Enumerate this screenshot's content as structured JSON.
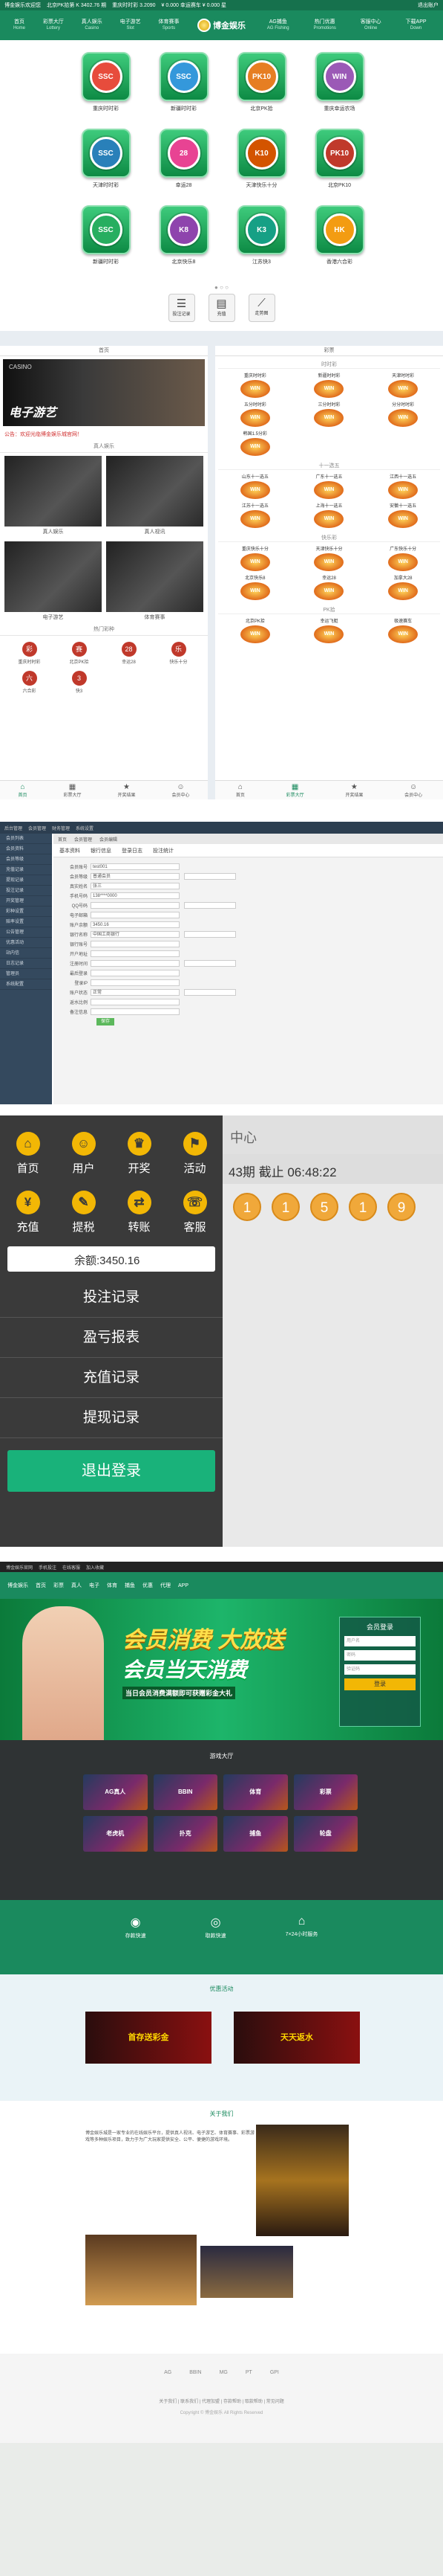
{
  "s1": {
    "topbar": {
      "brand": "博金娱乐欢迎您",
      "notice1": "北京PK拾第 K 3402.76 期",
      "notice2": "重庆时时彩 3.2090",
      "notice3": "¥ 0.000 幸运赛车 ¥ 0.000 星",
      "user": "退出账户"
    },
    "nav_left": [
      {
        "label": "首页",
        "sub": "Home"
      },
      {
        "label": "彩票大厅",
        "sub": "Lottery"
      },
      {
        "label": "真人娱乐",
        "sub": "Casino"
      },
      {
        "label": "电子游艺",
        "sub": "Slot"
      },
      {
        "label": "体育赛事",
        "sub": "Sports"
      }
    ],
    "logo_text": "博金娱乐",
    "nav_right": [
      {
        "label": "AG捕鱼",
        "sub": "AG Fishing"
      },
      {
        "label": "热门优惠",
        "sub": "Promotions"
      },
      {
        "label": "客服中心",
        "sub": "Online"
      },
      {
        "label": "下载APP",
        "sub": "Down"
      }
    ],
    "games": [
      {
        "label": "重庆时时彩",
        "badge": "SSC",
        "color": "#e74c3c"
      },
      {
        "label": "新疆时时彩",
        "badge": "SSC",
        "color": "#3498db"
      },
      {
        "label": "北京PK拾",
        "badge": "PK10",
        "color": "#e67e22"
      },
      {
        "label": "重庆幸运农场",
        "badge": "WIN",
        "color": "#9b59b6"
      },
      {
        "label": "天津时时彩",
        "badge": "SSC",
        "color": "#2980b9"
      },
      {
        "label": "幸运28",
        "badge": "28",
        "color": "#e84393"
      },
      {
        "label": "天津快乐十分",
        "badge": "K10",
        "color": "#d35400"
      },
      {
        "label": "北京PK10",
        "badge": "PK10",
        "color": "#c0392b"
      },
      {
        "label": "新疆时时彩",
        "badge": "SSC",
        "color": "#27ae60"
      },
      {
        "label": "北京快乐8",
        "badge": "K8",
        "color": "#8e44ad"
      },
      {
        "label": "江苏快3",
        "badge": "K3",
        "color": "#16a085"
      },
      {
        "label": "香港六合彩",
        "badge": "HK",
        "color": "#f39c12"
      }
    ],
    "dots": "● ○ ○",
    "tools": [
      {
        "label": "投注记录",
        "icon": "list-icon",
        "glyph": "☰"
      },
      {
        "label": "充值",
        "icon": "wallet-icon",
        "glyph": "▤"
      },
      {
        "label": "走势图",
        "icon": "chart-icon",
        "glyph": "⟋"
      }
    ]
  },
  "s2": {
    "left_head": "首页",
    "banner_small": "CASINO",
    "banner_title": "电子游艺",
    "marquee": "公告：欢迎光临博金娱乐城官网！",
    "photos_title": "真人娱乐",
    "photos": [
      {
        "caption": "真人娱乐"
      },
      {
        "caption": "真人视讯"
      },
      {
        "caption": "电子游艺"
      },
      {
        "caption": "体育赛事"
      }
    ],
    "icons_title": "热门彩种",
    "icons": [
      {
        "label": "重庆时时彩",
        "glyph": "彩"
      },
      {
        "label": "北京PK拾",
        "glyph": "赛"
      },
      {
        "label": "幸运28",
        "glyph": "28"
      },
      {
        "label": "快乐十分",
        "glyph": "乐"
      },
      {
        "label": "六合彩",
        "glyph": "六"
      },
      {
        "label": "快3",
        "glyph": "3"
      }
    ],
    "bottom_nav": [
      "首页",
      "彩票大厅",
      "开奖结果",
      "会员中心"
    ],
    "right_head": "彩票",
    "lot_sections": [
      {
        "title": "时时彩",
        "items": [
          "重庆时时彩",
          "新疆时时彩",
          "天津时时彩",
          "五分时时彩",
          "三分时时彩",
          "分分时时彩",
          "韩国1.5分彩"
        ]
      },
      {
        "title": "十一选五",
        "items": [
          "山东十一选五",
          "广东十一选五",
          "江西十一选五",
          "江苏十一选五",
          "上海十一选五",
          "安徽十一选五"
        ]
      },
      {
        "title": "快乐彩",
        "items": [
          "重庆快乐十分",
          "天津快乐十分",
          "广东快乐十分",
          "北京快乐8",
          "幸运28",
          "加拿大28"
        ]
      },
      {
        "title": "PK拾",
        "items": [
          "北京PK拾",
          "幸运飞艇",
          "极速赛车"
        ]
      }
    ]
  },
  "s3": {
    "top": [
      "后台管理",
      "会员管理",
      "财务管理",
      "系统设置"
    ],
    "side": [
      "会员列表",
      "会员资料",
      "会员等级",
      "充值记录",
      "提现记录",
      "投注记录",
      "开奖管理",
      "彩种设置",
      "赔率设置",
      "公告管理",
      "优惠活动",
      "站内信",
      "日志记录",
      "管理员",
      "系统配置"
    ],
    "tabs": [
      "首页",
      "会员管理",
      "会员编辑"
    ],
    "head": [
      "基本资料",
      "银行信息",
      "登录日志",
      "投注统计"
    ],
    "fields": [
      {
        "label": "会员账号",
        "value": "test001"
      },
      {
        "label": "会员等级",
        "value": "普通会员"
      },
      {
        "label": "真实姓名",
        "value": "张三"
      },
      {
        "label": "手机号码",
        "value": "138****0000"
      },
      {
        "label": "QQ号码",
        "value": ""
      },
      {
        "label": "电子邮箱",
        "value": ""
      },
      {
        "label": "账户余额",
        "value": "3450.16"
      },
      {
        "label": "银行名称",
        "value": "中国工商银行"
      },
      {
        "label": "银行账号",
        "value": ""
      },
      {
        "label": "开户地址",
        "value": ""
      },
      {
        "label": "注册时间",
        "value": ""
      },
      {
        "label": "最后登录",
        "value": ""
      },
      {
        "label": "登录IP",
        "value": ""
      },
      {
        "label": "账户状态",
        "value": "正常"
      },
      {
        "label": "返水比例",
        "value": ""
      },
      {
        "label": "备注信息",
        "value": ""
      }
    ],
    "save": "保存"
  },
  "s4": {
    "menu": [
      {
        "label": "首页",
        "icon": "home-icon",
        "glyph": "⌂"
      },
      {
        "label": "用户",
        "icon": "user-icon",
        "glyph": "☺"
      },
      {
        "label": "开奖",
        "icon": "draw-icon",
        "glyph": "♛"
      },
      {
        "label": "活动",
        "icon": "activity-icon",
        "glyph": "⚑"
      },
      {
        "label": "充值",
        "icon": "recharge-icon",
        "glyph": "¥"
      },
      {
        "label": "提税",
        "icon": "withdraw-icon",
        "glyph": "✎"
      },
      {
        "label": "转账",
        "icon": "transfer-icon",
        "glyph": "⇄"
      },
      {
        "label": "客服",
        "icon": "service-icon",
        "glyph": "☏"
      }
    ],
    "balance": "余额:3450.16",
    "links": [
      "投注记录",
      "盈亏报表",
      "充值记录",
      "提现记录"
    ],
    "logout": "退出登录",
    "game_head": "中心",
    "period": "43期 截止 06:48:22",
    "balls": [
      "1",
      "1",
      "5",
      "1",
      "9"
    ]
  },
  "s5": {
    "top": [
      "博金娱乐官网",
      "手机投注",
      "在线客服",
      "加入收藏"
    ],
    "nav": [
      "首页",
      "彩票",
      "真人",
      "电子",
      "体育",
      "捕鱼",
      "优惠",
      "代理",
      "APP"
    ],
    "promo1": "会员消费 大放送",
    "promo2": "会员当天消费",
    "promo3": "当日会员消费满额即可获赠彩金大礼",
    "login_title": "会员登录",
    "login_user": "用户名",
    "login_pass": "密码",
    "login_code": "验证码",
    "login_btn": "登录",
    "hall_title": "游戏大厅",
    "hall": [
      "AG真人",
      "BBIN",
      "体育",
      "彩票",
      "老虎机",
      "扑克",
      "捕鱼",
      "轮盘"
    ],
    "features": [
      {
        "label": "存款快速",
        "glyph": "◉"
      },
      {
        "label": "取款快速",
        "glyph": "◎"
      },
      {
        "label": "7×24小时服务",
        "glyph": "⌂"
      }
    ],
    "promos_title": "优惠活动",
    "promo_cards": [
      "首存送彩金",
      "天天返水"
    ],
    "about_title": "关于我们",
    "about_text": "博金娱乐城是一家专业的在线娱乐平台，提供真人视讯、电子游艺、体育赛事、彩票游戏等多种娱乐项目，致力于为广大玩家提供安全、公平、便捷的游戏环境。",
    "footer_logos": [
      "AG",
      "BBIN",
      "MG",
      "PT",
      "GPI"
    ],
    "footer_links": "关于我们 | 联系我们 | 代理加盟 | 存款帮助 | 取款帮助 | 常见问题",
    "footer_copy": "Copyright © 博金娱乐 All Rights Reserved"
  }
}
